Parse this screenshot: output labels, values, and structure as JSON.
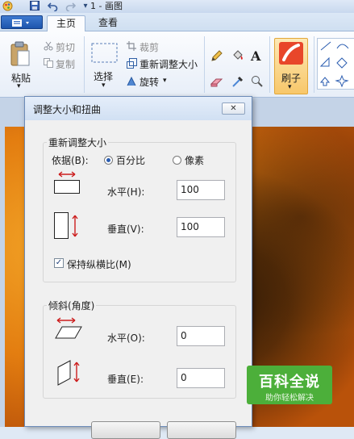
{
  "window": {
    "title": "1 - 画图"
  },
  "quick_access": {
    "icons": [
      "paint-app-icon",
      "save-icon",
      "undo-icon",
      "redo-icon",
      "customize-arrow-icon"
    ]
  },
  "ribbon": {
    "tabs": [
      {
        "label": "主页",
        "active": true
      },
      {
        "label": "查看",
        "active": false
      }
    ],
    "clipboard": {
      "paste": "粘贴",
      "cut": "剪切",
      "copy": "复制"
    },
    "image": {
      "select": "选择",
      "crop": "裁剪",
      "resize": "重新调整大小",
      "rotate": "旋转"
    },
    "tools": {
      "text_glyph": "A"
    },
    "brushes": "刷子"
  },
  "dialog": {
    "title": "调整大小和扭曲",
    "close_glyph": "✕",
    "resize": {
      "title": "重新调整大小",
      "by_label": "依据(B):",
      "option_percent": "百分比",
      "option_pixels": "像素",
      "selected": "百分比",
      "horizontal_label": "水平(H):",
      "horizontal_value": "100",
      "vertical_label": "垂直(V):",
      "vertical_value": "100",
      "maintain_label": "保持纵横比(M)",
      "maintain_checked": true
    },
    "skew": {
      "title": "倾斜(角度)",
      "horizontal_label": "水平(O):",
      "horizontal_value": "0",
      "vertical_label": "垂直(E):",
      "vertical_value": "0"
    }
  },
  "watermark": {
    "main": "百科全说",
    "sub": "助你轻松解决"
  },
  "colors": {
    "accent": "#2a5cb0",
    "arrow_red": "#cc1d1d",
    "watermark_green": "#4caf3a"
  }
}
